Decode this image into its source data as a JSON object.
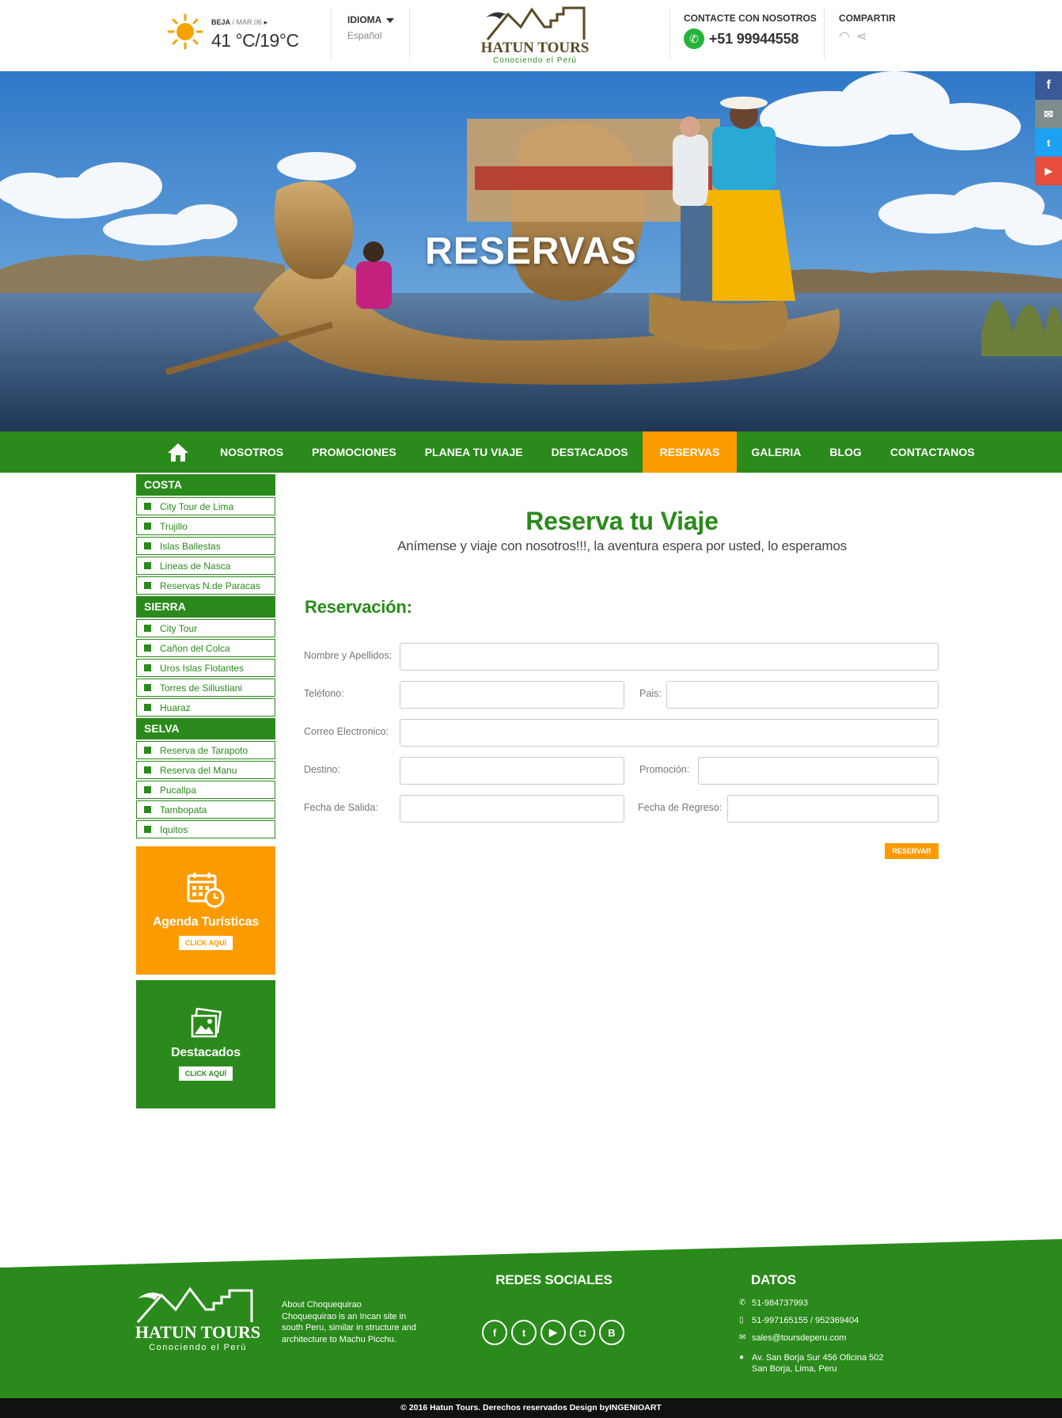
{
  "weather": {
    "location": "BEJA",
    "date": "/ MAR.06",
    "temp": "41 °C/19°C"
  },
  "language": {
    "label": "IDIOMA",
    "value": "Español"
  },
  "logo": {
    "name": "HATUN TOURS",
    "tagline": "Conociendo el Perú"
  },
  "contact": {
    "label": "CONTACTE CON NOSOTROS",
    "phone": "+51 99944558"
  },
  "share": {
    "label": "COMPARTIR"
  },
  "hero": {
    "title": "RESERVAS"
  },
  "nav": {
    "items": [
      "NOSOTROS",
      "PROMOCIONES",
      "PLANEA TU VIAJE",
      "DESTACADOS",
      "RESERVAS",
      "GALERIA",
      "BLOG",
      "CONTACTANOS"
    ],
    "active": "RESERVAS"
  },
  "sidebar": {
    "costa": {
      "title": "COSTA",
      "items": [
        "City Tour de Lima",
        "Trujillo",
        "Islas Ballestas",
        "Lineas de Nasca",
        "Reservas N.de Paracas"
      ]
    },
    "sierra": {
      "title": "SIERRA",
      "items": [
        "City Tour",
        "Cañon del Colca",
        "Uros Islas Flotantes",
        "Torres de Sillustiani",
        "Huaraz"
      ]
    },
    "selva": {
      "title": "SELVA",
      "items": [
        "Reserva de Tarapoto",
        "Reserva del Manu",
        "Pucallpa",
        "Tambopata",
        "Iquitos"
      ]
    },
    "agenda": {
      "title": "Agenda Turísticas",
      "button": "CLICK AQUÍ"
    },
    "destacados": {
      "title": "Destacados",
      "button": "CLICK AQUÍ"
    }
  },
  "main": {
    "title": "Reserva tu Viaje",
    "subtitle": "Anímense y viaje con nosotros!!!, la aventura espera por usted, lo esperamos",
    "section": "Reservación:",
    "labels": {
      "name": "Nombre y Apellidos:",
      "phone": "Teléfono:",
      "country": "Pais:",
      "email": "Correo Electronico:",
      "destination": "Destino:",
      "promotion": "Promoción:",
      "departure": "Fecha de Salida:",
      "return": "Fecha de Regreso:"
    },
    "submit": "RESERVAR"
  },
  "footer": {
    "about": "About Choquequirao Choquequirao is an Incan site in south Peru, similar in structure and architecture to Machu Picchu.",
    "social_title": "REDES SOCIALES",
    "data_title": "DATOS",
    "phone1": "51-984737993",
    "phone2": "51-997165155 / 952369404",
    "email": "sales@toursdeperu.com",
    "address1": "Av. San Borja Sur 456 Oficina 502",
    "address2": "San Borja, Lima, Peru",
    "copyright": "© 2016  Hatun Tours. Derechos reservados Design byINGENIOART"
  },
  "colors": {
    "green": "#2a8a1b",
    "orange": "#fb9b00"
  }
}
